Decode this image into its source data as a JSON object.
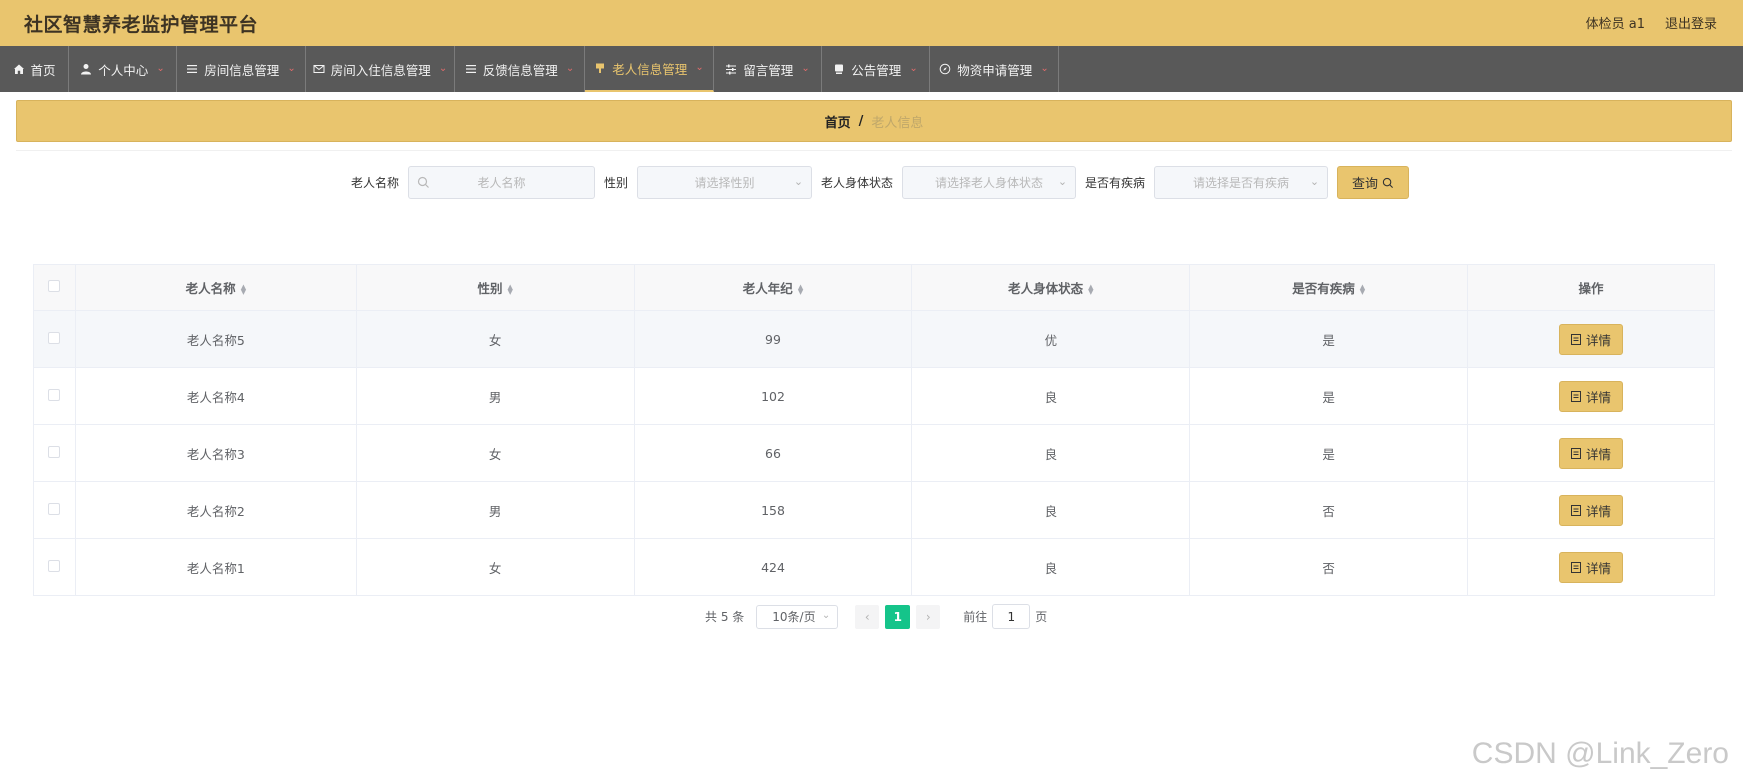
{
  "app": {
    "title": "社区智慧养老监护管理平台"
  },
  "user": {
    "name": "体检员 a1",
    "logout_label": "退出登录"
  },
  "nav": [
    {
      "label": "首页",
      "icon": "home-icon",
      "has_chevron": false
    },
    {
      "label": "个人中心",
      "icon": "user-icon",
      "has_chevron": true
    },
    {
      "label": "房间信息管理",
      "icon": "list-icon",
      "has_chevron": true
    },
    {
      "label": "房间入住信息管理",
      "icon": "mail-icon",
      "has_chevron": true
    },
    {
      "label": "反馈信息管理",
      "icon": "list-icon",
      "has_chevron": true
    },
    {
      "label": "老人信息管理",
      "icon": "marker-icon",
      "has_chevron": true,
      "active": true
    },
    {
      "label": "留言管理",
      "icon": "sliders-icon",
      "has_chevron": true
    },
    {
      "label": "公告管理",
      "icon": "bookmark-icon",
      "has_chevron": true
    },
    {
      "label": "物资申请管理",
      "icon": "compass-icon",
      "has_chevron": true
    }
  ],
  "breadcrumb": {
    "home": "首页",
    "separator": "/",
    "current": "老人信息"
  },
  "filters": {
    "name_label": "老人名称",
    "name_placeholder": "老人名称",
    "gender_label": "性别",
    "gender_placeholder": "请选择性别",
    "status_label": "老人身体状态",
    "status_placeholder": "请选择老人身体状态",
    "disease_label": "是否有疾病",
    "disease_placeholder": "请选择是否有疾病",
    "search_label": "查询"
  },
  "table": {
    "columns": [
      "老人名称",
      "性别",
      "老人年纪",
      "老人身体状态",
      "是否有疾病",
      "操作"
    ],
    "rows": [
      {
        "name": "老人名称5",
        "gender": "女",
        "age": "99",
        "status": "优",
        "disease": "是"
      },
      {
        "name": "老人名称4",
        "gender": "男",
        "age": "102",
        "status": "良",
        "disease": "是"
      },
      {
        "name": "老人名称3",
        "gender": "女",
        "age": "66",
        "status": "良",
        "disease": "是"
      },
      {
        "name": "老人名称2",
        "gender": "男",
        "age": "158",
        "status": "良",
        "disease": "否"
      },
      {
        "name": "老人名称1",
        "gender": "女",
        "age": "424",
        "status": "良",
        "disease": "否"
      }
    ],
    "detail_label": "详情"
  },
  "pagination": {
    "total": "共 5 条",
    "page_size": "10条/页",
    "prev": "‹",
    "current_page": "1",
    "next": "›",
    "goto_label": "前往",
    "goto_value": "1",
    "page_unit": "页"
  },
  "watermark": "CSDN @Link_Zero",
  "colors": {
    "accent": "#e9c56e",
    "nav_bg": "#595959",
    "page_active": "#15c48a"
  }
}
